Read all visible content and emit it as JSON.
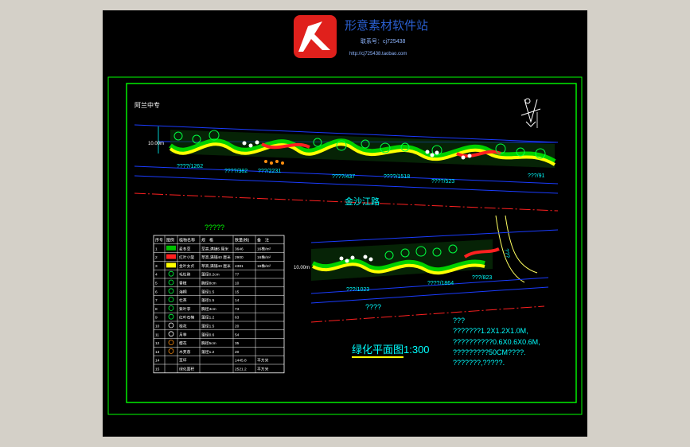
{
  "watermark": {
    "site_name": "形意素材软件站",
    "line2": "联系号：cj725438",
    "line3": "http://cj725438.taobao.com"
  },
  "drawing": {
    "road_name": "金沙江路",
    "left_label": "阿兰中专",
    "width_label_top": "10.00m",
    "width_label_bottom": "10.00m",
    "question_labels": [
      "?????",
      "????",
      "???",
      "???"
    ],
    "top_strip_labels": [
      "????/1262",
      "????/382",
      "???/2231",
      "????/437",
      "????/1518",
      "????/523",
      "???/91"
    ],
    "bottom_strip_labels": [
      "???/1023",
      "????/1864",
      "???/823"
    ],
    "legend_title": "?????",
    "notes": [
      "???????1.2X1.2X1.0M,",
      "??????????0.6X0.6X0.6M,",
      "?????????50CM????.",
      "???????,?????."
    ],
    "plan_title": "绿化平面图1:300"
  },
  "legend_table": {
    "headers": [
      "序号",
      "图例",
      "植物名称",
      "规　格",
      "数量(株)",
      "备　注"
    ],
    "rows": [
      {
        "no": "1",
        "name": "麦冬草",
        "spec": "草高,满铺5 厘米",
        "qty": "3646",
        "note": "16株/m²",
        "swatch": "green-stripe"
      },
      {
        "no": "2",
        "name": "红叶小檗",
        "spec": "草高,满铺40 厘米",
        "qty": "2900",
        "note": "16株/m²",
        "swatch": "red-stripe"
      },
      {
        "no": "3",
        "name": "金叶女贞",
        "spec": "草高,满铺40 厘米",
        "qty": "4381",
        "note": "16株/m²",
        "swatch": "yellow-stripe"
      },
      {
        "no": "4",
        "name": "毛杜鹃",
        "spec": "蓬径0.2cm",
        "qty": "77",
        "note": "",
        "swatch": "shrub"
      },
      {
        "no": "5",
        "name": "香樟",
        "spec": "胸径8cm",
        "qty": "10",
        "note": "",
        "swatch": "tree"
      },
      {
        "no": "6",
        "name": "海桐",
        "spec": "蓬径1.5",
        "qty": "15",
        "note": "",
        "swatch": "tree"
      },
      {
        "no": "7",
        "name": "杜英",
        "spec": "蓬径1.5",
        "qty": "14",
        "note": "",
        "swatch": "tree"
      },
      {
        "no": "8",
        "name": "紫叶李",
        "spec": "胸径4cm",
        "qty": "73",
        "note": "",
        "swatch": "tree"
      },
      {
        "no": "9",
        "name": "红叶石楠",
        "spec": "蓬径1.2",
        "qty": "63",
        "note": "",
        "swatch": "tree"
      },
      {
        "no": "10",
        "name": "桂花",
        "spec": "蓬径1.5",
        "qty": "20",
        "note": "",
        "swatch": "flower"
      },
      {
        "no": "11",
        "name": "月季",
        "spec": "蓬径0.6",
        "qty": "54",
        "note": "",
        "swatch": "flower"
      },
      {
        "no": "12",
        "name": "樱花",
        "spec": "胸径5cm",
        "qty": "35",
        "note": "",
        "swatch": "flower-orange"
      },
      {
        "no": "13",
        "name": "木芙蓉",
        "spec": "蓬径1.2",
        "qty": "20",
        "note": "",
        "swatch": "flower-orange"
      },
      {
        "no": "14",
        "name": "草坪",
        "spec": "",
        "qty": "1445.8",
        "note": "平方米",
        "swatch": ""
      },
      {
        "no": "15",
        "name": "绿化面积",
        "spec": "",
        "qty": "2521.2",
        "note": "平方米",
        "swatch": ""
      }
    ]
  },
  "colors": {
    "frame": "#00ff00",
    "road_line": "#0000ff",
    "center_line": "#ff0000",
    "label": "#00ffff",
    "title": "#00ffff",
    "hedge_green": "#00c000",
    "hedge_red": "#ff2020",
    "hedge_yellow": "#ffff00",
    "logo_red": "#e0201c"
  }
}
